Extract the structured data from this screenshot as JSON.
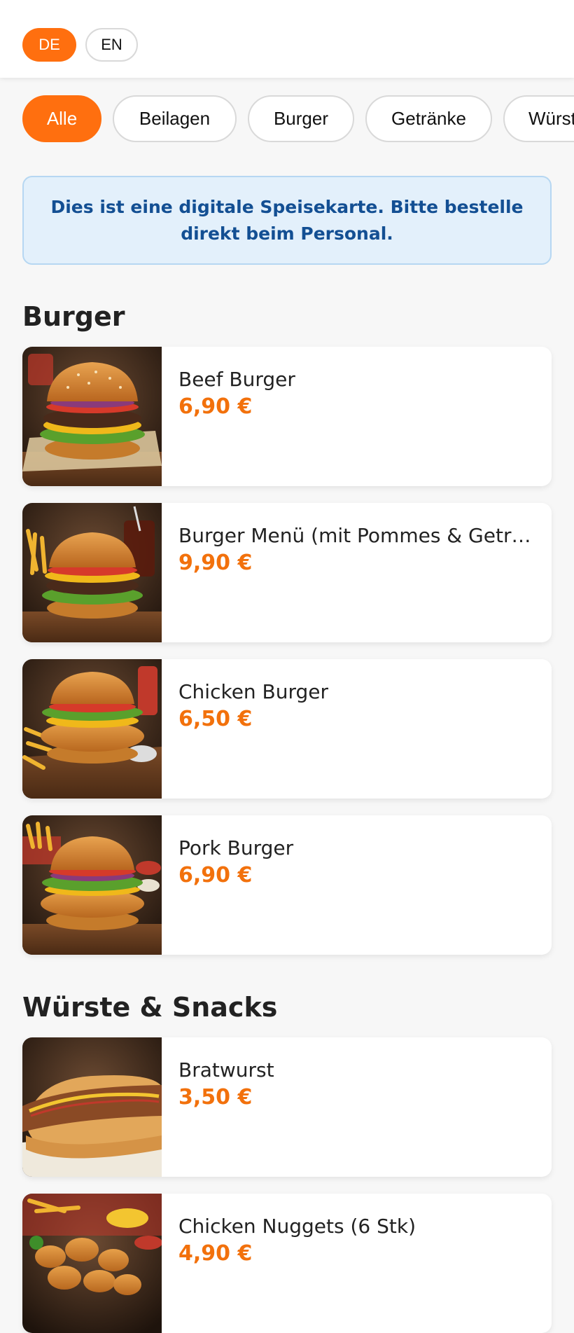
{
  "languages": {
    "de": "DE",
    "en": "EN",
    "active": "DE"
  },
  "categories": [
    "Alle",
    "Beilagen",
    "Burger",
    "Getränke",
    "Würste & Snacks"
  ],
  "notice": "Dies ist eine digitale Speisekarte. Bitte bestelle direkt beim Personal.",
  "sections": [
    {
      "title": "Burger",
      "items": [
        {
          "name": "Beef Burger",
          "price": "6,90 €",
          "image": "beef-burger-photo"
        },
        {
          "name": "Burger Menü (mit Pommes & Getränk)",
          "price": "9,90 €",
          "image": "burger-menu-photo"
        },
        {
          "name": "Chicken Burger",
          "price": "6,50 €",
          "image": "chicken-burger-photo"
        },
        {
          "name": "Pork Burger",
          "price": "6,90 €",
          "image": "pork-burger-photo"
        }
      ]
    },
    {
      "title": "Würste & Snacks",
      "items": [
        {
          "name": "Bratwurst",
          "price": "3,50 €",
          "image": "bratwurst-photo"
        },
        {
          "name": "Chicken Nuggets (6 Stk)",
          "price": "4,90 €",
          "image": "chicken-nuggets-photo"
        }
      ]
    }
  ],
  "colors": {
    "accent": "#ff6f0f",
    "price": "#f2710c",
    "notice_bg": "#e3f0fb",
    "notice_text": "#134f93"
  }
}
